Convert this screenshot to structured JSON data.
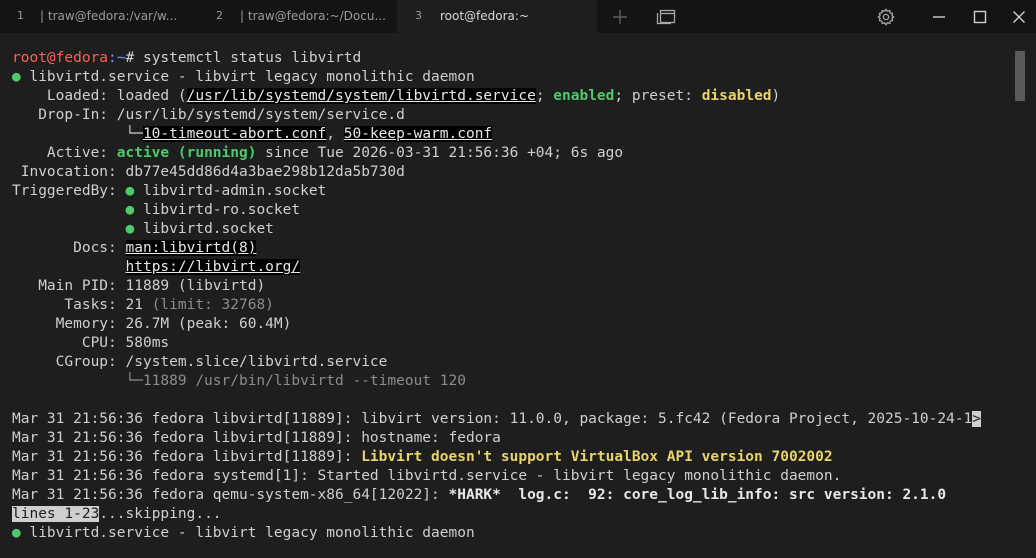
{
  "tabs": [
    {
      "number": "1",
      "title": "| traw@fedora:/var/w..."
    },
    {
      "number": "2",
      "title": "| traw@fedora:~/Docu..."
    },
    {
      "number": "3",
      "title": "root@fedora:~"
    }
  ],
  "toolbar": {
    "new_tab_icon": "plus-icon",
    "tab_overview_icon": "tab-overview-icon",
    "settings_icon": "gear-icon",
    "minimize_icon": "minimize-icon",
    "maximize_icon": "maximize-icon",
    "close_icon": "close-icon"
  },
  "colors": {
    "background": "#1e1e1e",
    "prompt_user": "#ff5f56",
    "prompt_path": "#6f9df1",
    "status_green": "#4ec96b",
    "warning_yellow": "#e9d36a"
  },
  "terminal": {
    "prompt_user": "root@fedora",
    "prompt_path": ":~",
    "prompt_symbol": "# ",
    "command": "systemctl status libvirtd",
    "service_header": {
      "bullet": "●",
      "text": " libvirtd.service - libvirt legacy monolithic daemon"
    },
    "loaded": {
      "label": "    Loaded: ",
      "prefix": "loaded (",
      "path": "/usr/lib/systemd/system/libvirtd.service",
      "sep1": "; ",
      "enabled": "enabled",
      "sep2": "; preset: ",
      "preset": "disabled",
      "suffix": ")"
    },
    "dropin": {
      "label": "   Drop-In: ",
      "path": "/usr/lib/systemd/system/service.d",
      "indent": "             └─",
      "file1": "10-timeout-abort.conf",
      "sep": ", ",
      "file2": "50-keep-warm.conf"
    },
    "active": {
      "label": "    Active: ",
      "state": "active (running)",
      "since": " since Tue 2026-03-31 21:56:36 +04; 6s ago"
    },
    "invocation": {
      "label": " Invocation: ",
      "value": "db77e45dd86d4a3bae298b12da5b730d"
    },
    "triggered_by": {
      "label": "TriggeredBy: ",
      "indent": "             ",
      "bullet": "●",
      "items": [
        " libvirtd-admin.socket",
        " libvirtd-ro.socket",
        " libvirtd.socket"
      ]
    },
    "docs": {
      "label": "       Docs: ",
      "indent": "             ",
      "items": [
        "man:libvirtd(8)",
        "https://libvirt.org/"
      ]
    },
    "main_pid": {
      "label": "   Main PID: ",
      "value": "11889 (libvirtd)"
    },
    "tasks": {
      "label": "      Tasks: ",
      "value": "21",
      "limit": " (limit: 32768)"
    },
    "memory": {
      "label": "     Memory: ",
      "value": "26.7M (peak: 60.4M)"
    },
    "cpu": {
      "label": "        CPU: ",
      "value": "580ms"
    },
    "cgroup": {
      "label": "     CGroup: ",
      "value": "/system.slice/libvirtd.service",
      "child": "             └─11889 /usr/bin/libvirtd --timeout 120"
    },
    "log": [
      {
        "prefix": "Mar 31 21:56:36 fedora libvirtd[11889]: ",
        "message": "libvirt version: 11.0.0, package: 5.fc42 (Fedora Project, 2025-10-24-1",
        "trunc": ">"
      },
      {
        "prefix": "Mar 31 21:56:36 fedora libvirtd[11889]: ",
        "message": "hostname: fedora"
      },
      {
        "prefix": "Mar 31 21:56:36 fedora libvirtd[11889]: ",
        "message": "Libvirt doesn't support VirtualBox API version 7002002"
      },
      {
        "prefix": "Mar 31 21:56:36 fedora systemd[1]: ",
        "message": "Started libvirtd.service - libvirt legacy monolithic daemon."
      },
      {
        "prefix": "Mar 31 21:56:36 fedora qemu-system-x86_64[12022]: ",
        "message": "*HARK*  log.c:  92: core_log_lib_info: src version: 2.1.0"
      }
    ],
    "pager": {
      "status": "lines 1-23",
      "rest": "...skipping..."
    },
    "repeat_header": {
      "bullet": "●",
      "text": " libvirtd.service - libvirt legacy monolithic daemon"
    }
  }
}
